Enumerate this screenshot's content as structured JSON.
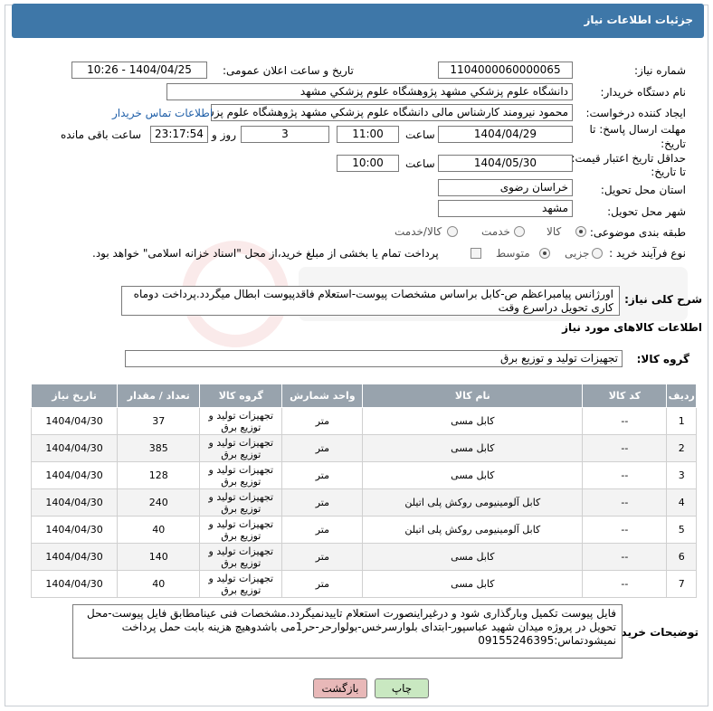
{
  "header": {
    "title": "جزئیات اطلاعات نیاز"
  },
  "fields": {
    "need_number_label": "شماره نیاز:",
    "need_number": "1104000060000065",
    "announce_label": "تاریخ و ساعت اعلان عمومی:",
    "announce_value": "1404/04/25 - 10:26",
    "buyer_org_label": "نام دستگاه خریدار:",
    "buyer_org": "دانشگاه علوم پزشکي مشهد   پژوهشگاه علوم پزشکي مشهد",
    "creator_label": "ایجاد کننده درخواست:",
    "creator": "محمود نیرومند کارشناس مالی دانشگاه علوم پزشکي مشهد   پژوهشگاه علوم پزشکي مشهد",
    "contact_link": "اطلاعات تماس خریدار",
    "deadline_label_1": "مهلت ارسال پاسخ: تا",
    "deadline_label_2": "تاریخ:",
    "deadline_date": "1404/04/29",
    "time_label": "ساعت",
    "deadline_time": "11:00",
    "days_value": "3",
    "days_label": "روز و",
    "remaining_time": "23:17:54",
    "remaining_label": "ساعت باقی مانده",
    "price_label_1": "حداقل تاریخ اعتبار قیمت:",
    "price_label_2": "تا تاریخ:",
    "price_date": "1404/05/30",
    "price_time": "10:00",
    "province_label": "استان محل تحویل:",
    "province": "خراسان رضوی",
    "city_label": "شهر محل تحویل:",
    "city": "مشهد",
    "category_label": "طبقه بندی موضوعی:",
    "category_options": [
      "کالا",
      "خدمت",
      "کالا/خدمت"
    ],
    "process_label": "نوع فرآیند خرید :",
    "process_options": [
      "جزیی",
      "متوسط"
    ],
    "payment_note": "پرداخت تمام یا بخشی از مبلغ خرید،از محل \"اسناد خزانه اسلامی\" خواهد بود."
  },
  "description": {
    "label": "شرح کلی نیاز:",
    "text": "اورژانس پیامبراعظم ص-کابل براساس مشخصات پیوست-استعلام فاقدپیوست ابطال میگردد.پرداخت دوماه کاری تحویل دراسرع وقت"
  },
  "goods_section": {
    "title": "اطلاعات کالاهای مورد نیاز",
    "group_label": "گروه کالا:",
    "group_value": "تجهیزات تولید و توزیع برق"
  },
  "table": {
    "headers": [
      "ردیف",
      "کد کالا",
      "نام کالا",
      "واحد شمارش",
      "گروه کالا",
      "تعداد / مقدار",
      "تاریخ نیاز"
    ],
    "rows": [
      [
        "1",
        "--",
        "کابل مسی",
        "متر",
        "تجهیزات تولید و توزیع برق",
        "37",
        "1404/04/30"
      ],
      [
        "2",
        "--",
        "کابل مسی",
        "متر",
        "تجهیزات تولید و توزیع برق",
        "385",
        "1404/04/30"
      ],
      [
        "3",
        "--",
        "کابل مسی",
        "متر",
        "تجهیزات تولید و توزیع برق",
        "128",
        "1404/04/30"
      ],
      [
        "4",
        "--",
        "کابل آلومینیومی روکش پلی اتیلن",
        "متر",
        "تجهیزات تولید و توزیع برق",
        "240",
        "1404/04/30"
      ],
      [
        "5",
        "--",
        "کابل آلومینیومی روکش پلی اتیلن",
        "متر",
        "تجهیزات تولید و توزیع برق",
        "40",
        "1404/04/30"
      ],
      [
        "6",
        "--",
        "کابل مسی",
        "متر",
        "تجهیزات تولید و توزیع برق",
        "140",
        "1404/04/30"
      ],
      [
        "7",
        "--",
        "کابل مسی",
        "متر",
        "تجهیزات تولید و توزیع برق",
        "40",
        "1404/04/30"
      ]
    ]
  },
  "buyer_notes": {
    "label": "توضیحات خریدار:",
    "text": "فایل پیوست تکمیل وبارگذاری شود و درغیراینصورت استعلام تاییدنمیگردد.مشخصات فنی عینامطابق فایل پیوست-محل تحویل در پروژه میدان شهید عباسپور-ابتدای بلوارسرخس-بولوارحر-حر1می باشدوهیچ هزینه بابت حمل  پرداخت نمیشودتماس:09155246395"
  },
  "buttons": {
    "print": "چاپ",
    "back": "بازگشت"
  },
  "colors": {
    "header_bg": "#3e77a8",
    "table_header_bg": "#98a3ad",
    "link": "#1f5fa8",
    "back_button": "#e8b8b8",
    "print_button": "#c9e8c1"
  }
}
